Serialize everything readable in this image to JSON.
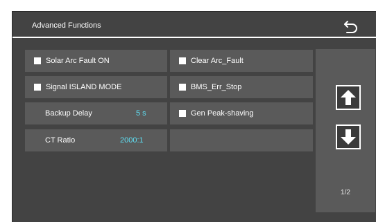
{
  "header": {
    "title": "Advanced Functions",
    "back_icon": "back-arrow-icon"
  },
  "left_column": [
    {
      "label": "Solar Arc Fault ON",
      "checkbox": true
    },
    {
      "label": "Signal ISLAND MODE",
      "checkbox": true
    },
    {
      "label": "Backup Delay",
      "value": "5 s"
    },
    {
      "label": "CT Ratio",
      "value": "2000:1"
    }
  ],
  "right_column": [
    {
      "label": "Clear Arc_Fault",
      "checkbox": true
    },
    {
      "label": "BMS_Err_Stop",
      "checkbox": true
    },
    {
      "label": "Gen Peak-shaving",
      "checkbox": true
    },
    {
      "label": ""
    }
  ],
  "pager": {
    "page": "1/2",
    "up_icon": "arrow-up-icon",
    "down_icon": "arrow-down-icon"
  },
  "colors": {
    "background": "#434343",
    "cell": "#5a5a5a",
    "value": "#5fe0f5"
  }
}
